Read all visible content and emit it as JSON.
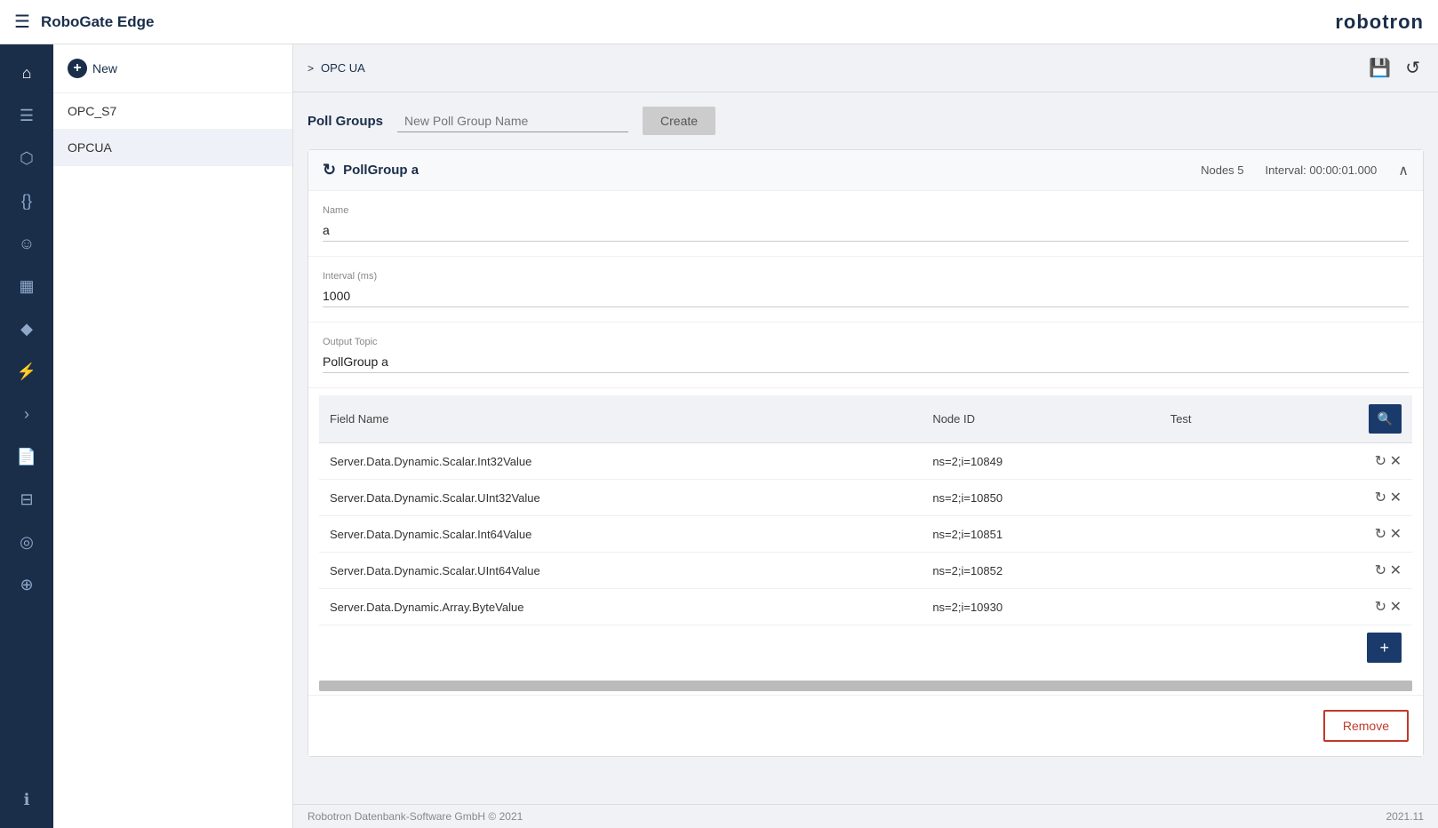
{
  "topbar": {
    "title": "RoboGate Edge",
    "logo": "robotron"
  },
  "breadcrumb": {
    "chevron": ">",
    "text": "OPC UA"
  },
  "sidebar": {
    "items": [
      {
        "id": "home",
        "icon": "⌂"
      },
      {
        "id": "sliders",
        "icon": "⧉"
      },
      {
        "id": "share",
        "icon": "⬡"
      },
      {
        "id": "code",
        "icon": "{}"
      },
      {
        "id": "person",
        "icon": "☺"
      },
      {
        "id": "grid",
        "icon": "▦"
      },
      {
        "id": "diamond",
        "icon": "◆"
      },
      {
        "id": "chart",
        "icon": "⚡"
      },
      {
        "id": "arrow",
        "icon": ">"
      },
      {
        "id": "file",
        "icon": "📄"
      },
      {
        "id": "layers",
        "icon": "⊟"
      },
      {
        "id": "target",
        "icon": "◎"
      },
      {
        "id": "stack",
        "icon": "⊕"
      },
      {
        "id": "info",
        "icon": "ℹ"
      }
    ]
  },
  "left_panel": {
    "new_label": "New",
    "items": [
      {
        "id": "opc_s7",
        "label": "OPC_S7",
        "active": false
      },
      {
        "id": "opcua",
        "label": "OPCUA",
        "active": true
      }
    ]
  },
  "poll_groups": {
    "label": "Poll Groups",
    "input_placeholder": "New Poll Group Name",
    "create_label": "Create"
  },
  "poll_card": {
    "refresh_icon": "↻",
    "title": "PollGroup a",
    "nodes_text": "Nodes 5",
    "interval_text": "Interval: 00:00:01.000",
    "collapse_icon": "∧",
    "name_label": "Name",
    "name_value": "a",
    "interval_label": "Interval (ms)",
    "interval_value": "1000",
    "output_topic_label": "Output Topic",
    "output_topic_value": "PollGroup a",
    "table": {
      "columns": [
        {
          "key": "field_name",
          "label": "Field Name"
        },
        {
          "key": "node_id",
          "label": "Node ID"
        },
        {
          "key": "test",
          "label": "Test"
        },
        {
          "key": "actions",
          "label": ""
        }
      ],
      "rows": [
        {
          "field_name": "Server.Data.Dynamic.Scalar.Int32Value",
          "node_id": "ns=2;i=10849",
          "test": ""
        },
        {
          "field_name": "Server.Data.Dynamic.Scalar.UInt32Value",
          "node_id": "ns=2;i=10850",
          "test": ""
        },
        {
          "field_name": "Server.Data.Dynamic.Scalar.Int64Value",
          "node_id": "ns=2;i=10851",
          "test": ""
        },
        {
          "field_name": "Server.Data.Dynamic.Scalar.UInt64Value",
          "node_id": "ns=2;i=10852",
          "test": ""
        },
        {
          "field_name": "Server.Data.Dynamic.Array.ByteValue",
          "node_id": "ns=2;i=10930",
          "test": ""
        }
      ]
    },
    "add_label": "+",
    "search_icon": "🔍",
    "refresh_row_icon": "↻",
    "remove_row_icon": "✕",
    "remove_label": "Remove"
  },
  "footer": {
    "copyright": "Robotron Datenbank-Software GmbH © 2021",
    "version": "2021.11"
  },
  "action_icons": {
    "save": "💾",
    "restore": "↺"
  }
}
